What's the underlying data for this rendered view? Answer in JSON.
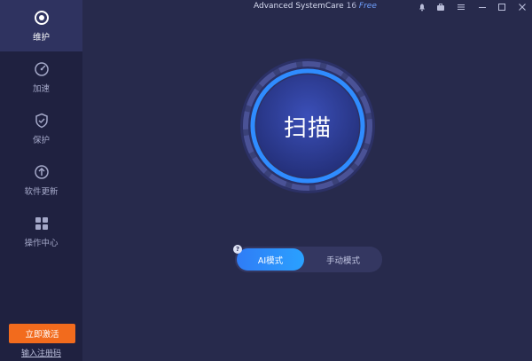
{
  "app": {
    "name": "Advanced SystemCare",
    "version": "16",
    "edition": "Free"
  },
  "sidebar": {
    "items": [
      {
        "label": "维护",
        "icon": "maintenance-icon",
        "active": true
      },
      {
        "label": "加速",
        "icon": "speedometer-icon",
        "active": false
      },
      {
        "label": "保护",
        "icon": "shield-icon",
        "active": false
      },
      {
        "label": "软件更新",
        "icon": "upload-icon",
        "active": false
      },
      {
        "label": "操作中心",
        "icon": "grid-icon",
        "active": false
      }
    ],
    "activate_label": "立即激活",
    "register_label": "输入注册码"
  },
  "main": {
    "scan_label": "扫描",
    "modes": {
      "ai_label": "AI模式",
      "manual_label": "手动模式",
      "help_glyph": "?"
    }
  },
  "colors": {
    "sidebar_bg": "#1f2140",
    "main_bg": "#272a4c",
    "accent": "#2f7cf6",
    "activate": "#f26b1d"
  }
}
